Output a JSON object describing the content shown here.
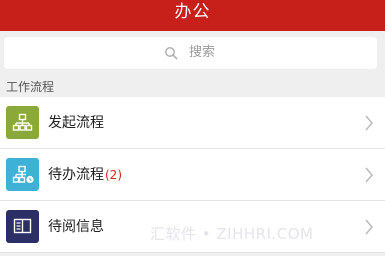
{
  "header": {
    "title": "办公"
  },
  "search": {
    "placeholder": "搜索",
    "icon": "search-icon"
  },
  "section": {
    "label": "工作流程"
  },
  "items": [
    {
      "label": "发起流程",
      "count": "",
      "icon": "org-chart-icon",
      "icon_color": "#8aa93a"
    },
    {
      "label": "待办流程",
      "count": "(2)",
      "icon": "pending-flow-icon",
      "icon_color": "#3fb1d6"
    },
    {
      "label": "待阅信息",
      "count": "",
      "icon": "read-document-icon",
      "icon_color": "#2b2f66"
    }
  ],
  "watermark": {
    "text": "汇软件 • ZIHHRI.COM"
  },
  "colors": {
    "header": "#c7201a",
    "badge": "#d42a1e"
  }
}
